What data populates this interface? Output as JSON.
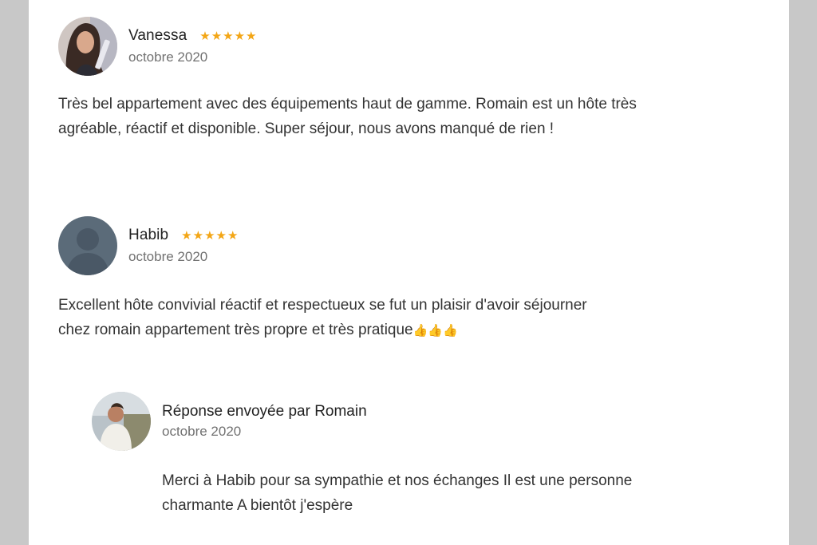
{
  "reviews": [
    {
      "name": "Vanessa",
      "rating": 5,
      "date": "octobre 2020",
      "text": "Très bel appartement avec des équipements haut de gamme. Romain est un hôte très agréable, réactif et disponible. Super séjour, nous avons manqué de rien !",
      "avatar": "photo-woman-icon"
    },
    {
      "name": "Habib",
      "rating": 5,
      "date": "octobre 2020",
      "text": "Excellent hôte convivial réactif et respectueux se fut un plaisir d'avoir séjourner chez romain appartement très propre et très pratique",
      "emoji": "👍👍👍",
      "avatar": "default-user-icon"
    }
  ],
  "reply": {
    "title": "Réponse envoyée par Romain",
    "date": "octobre 2020",
    "text": "Merci à Habib pour sa sympathie et nos échanges Il est une personne charmante A bientôt j'espère",
    "avatar": "photo-man-icon"
  },
  "colors": {
    "star": "#f3a616",
    "side_gutter": "#c8c8c8",
    "panel": "#ffffff",
    "default_avatar": "#5b6b79"
  }
}
